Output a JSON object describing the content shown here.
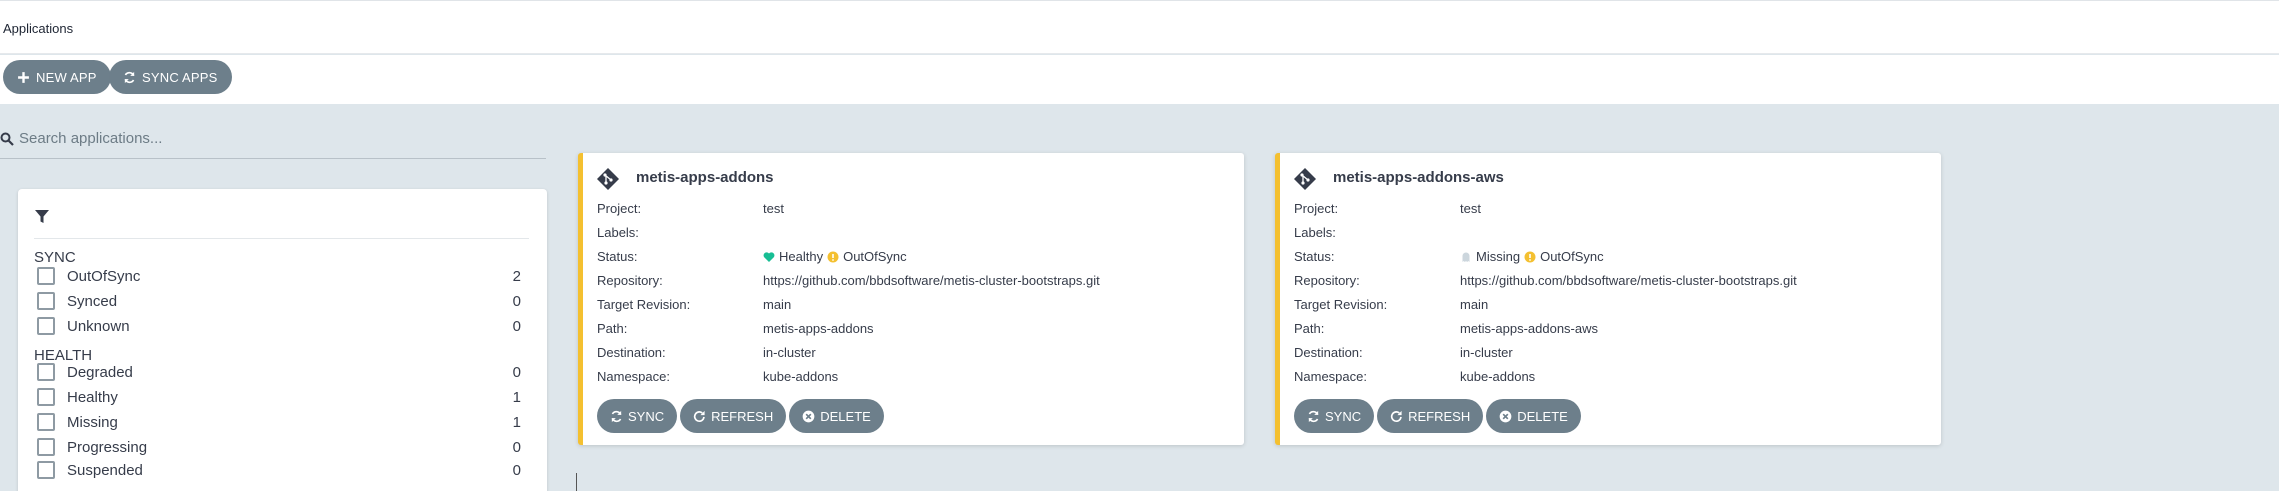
{
  "header": {
    "title": "Applications"
  },
  "toolbar": {
    "new_app": "NEW APP",
    "sync_apps": "SYNC APPS"
  },
  "search": {
    "placeholder": "Search applications..."
  },
  "filters": {
    "sync_title": "SYNC",
    "sync": [
      {
        "label": "OutOfSync",
        "count": "2"
      },
      {
        "label": "Synced",
        "count": "0"
      },
      {
        "label": "Unknown",
        "count": "0"
      }
    ],
    "health_title": "HEALTH",
    "health": [
      {
        "label": "Degraded",
        "count": "0"
      },
      {
        "label": "Healthy",
        "count": "1"
      },
      {
        "label": "Missing",
        "count": "1"
      },
      {
        "label": "Progressing",
        "count": "0"
      },
      {
        "label": "Suspended",
        "count": "0"
      }
    ]
  },
  "labels": {
    "project": "Project:",
    "labels": "Labels:",
    "status": "Status:",
    "repository": "Repository:",
    "target_revision": "Target Revision:",
    "path": "Path:",
    "destination": "Destination:",
    "namespace": "Namespace:"
  },
  "apps": [
    {
      "name": "metis-apps-addons",
      "project": "test",
      "labels": "",
      "health": "Healthy",
      "sync": "OutOfSync",
      "repository": "https://github.com/bbdsoftware/metis-cluster-bootstraps.git",
      "target_revision": "main",
      "path": "metis-apps-addons",
      "destination": "in-cluster",
      "namespace": "kube-addons",
      "buttons": {
        "sync": "SYNC",
        "refresh": "REFRESH",
        "delete": "DELETE"
      }
    },
    {
      "name": "metis-apps-addons-aws",
      "project": "test",
      "labels": "",
      "health": "Missing",
      "sync": "OutOfSync",
      "repository": "https://github.com/bbdsoftware/metis-cluster-bootstraps.git",
      "target_revision": "main",
      "path": "metis-apps-addons-aws",
      "destination": "in-cluster",
      "namespace": "kube-addons",
      "buttons": {
        "sync": "SYNC",
        "refresh": "REFRESH",
        "delete": "DELETE"
      }
    }
  ],
  "colors": {
    "accent_bar": "#f4c030",
    "healthy": "#18be94",
    "out_of_sync": "#f4c030",
    "missing": "#ccd6dd",
    "button": "#6d7f8b"
  }
}
